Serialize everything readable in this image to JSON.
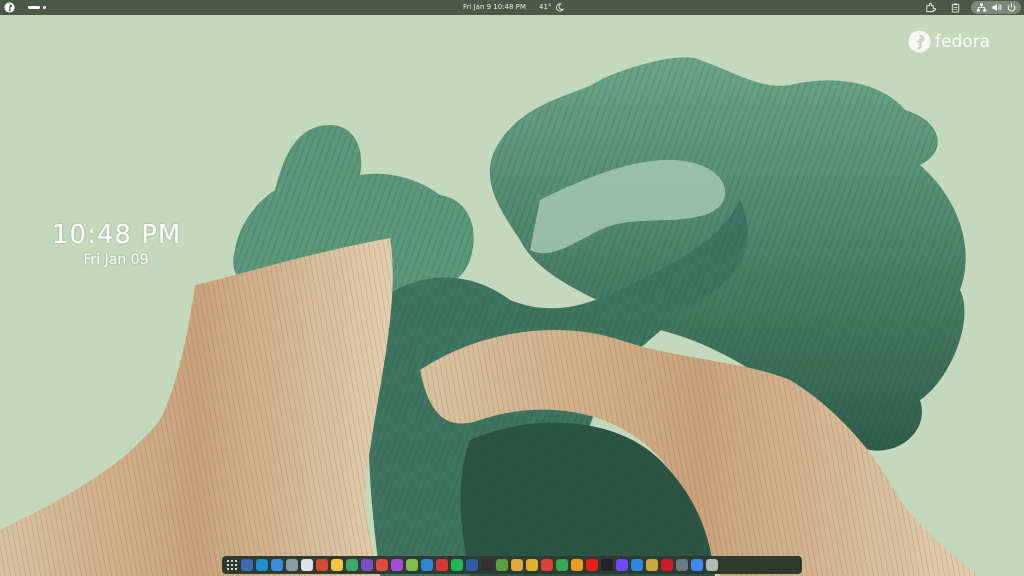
{
  "topbar": {
    "clock": "Fri Jan 9  10:48 PM",
    "temperature": "41°",
    "weather_icon": "clear-night-icon",
    "right_icons": [
      "extensions-icon",
      "clipboard-icon",
      "network-icon",
      "volume-icon",
      "power-icon"
    ]
  },
  "brand": {
    "text": "fedora"
  },
  "desktop_clock": {
    "time": "10:48 PM",
    "date": "Fri Jan 09"
  },
  "dock": {
    "apps": [
      {
        "name": "app-grid",
        "color": "#00000000"
      },
      {
        "name": "fedora-media-writer",
        "color": "#3c6eb4"
      },
      {
        "name": "edge",
        "color": "#1a8fd1"
      },
      {
        "name": "chromium",
        "color": "#3b8bd9"
      },
      {
        "name": "files",
        "color": "#8a9aa3"
      },
      {
        "name": "text-editor",
        "color": "#dfe3e6"
      },
      {
        "name": "gift",
        "color": "#d44a3a"
      },
      {
        "name": "notes",
        "color": "#f5c542"
      },
      {
        "name": "layers",
        "color": "#3fa66a"
      },
      {
        "name": "firefox",
        "color": "#7a4fc4"
      },
      {
        "name": "pinwheel",
        "color": "#e24a3b"
      },
      {
        "name": "media-player",
        "color": "#a64fd6"
      },
      {
        "name": "lime",
        "color": "#7cc04a"
      },
      {
        "name": "browser",
        "color": "#2d86d9"
      },
      {
        "name": "calendar",
        "color": "#d93a2f"
      },
      {
        "name": "spotify",
        "color": "#1db954"
      },
      {
        "name": "steam",
        "color": "#2b5fa3"
      },
      {
        "name": "terminal",
        "color": "#303030"
      },
      {
        "name": "minecraft",
        "color": "#5aa03c"
      },
      {
        "name": "folder",
        "color": "#e0a93a"
      },
      {
        "name": "chrome",
        "color": "#e0b12a"
      },
      {
        "name": "gmail",
        "color": "#d94335"
      },
      {
        "name": "drive",
        "color": "#34a853"
      },
      {
        "name": "photos",
        "color": "#f29c1f"
      },
      {
        "name": "youtube",
        "color": "#e62117"
      },
      {
        "name": "github",
        "color": "#1f2328"
      },
      {
        "name": "proton",
        "color": "#6d4aff"
      },
      {
        "name": "vscode",
        "color": "#2a8ae0"
      },
      {
        "name": "gimp",
        "color": "#c9a93b"
      },
      {
        "name": "netflix",
        "color": "#d11a2a"
      },
      {
        "name": "settings",
        "color": "#6a7a82"
      },
      {
        "name": "sparkle",
        "color": "#3d8bf0"
      },
      {
        "name": "trash",
        "color": "#b0b8b4"
      }
    ]
  },
  "colors": {
    "wallpaper_bg": "#c4d9bc",
    "topbar_bg": "#4a5a47",
    "foliage": "#4f8a6c",
    "wood": "#cfb08a"
  }
}
